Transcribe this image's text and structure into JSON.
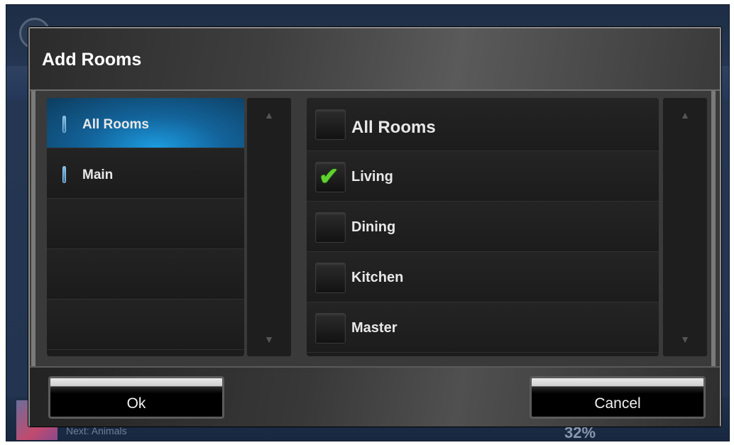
{
  "background": {
    "footer_text": "Next: Animals",
    "percent": "32%"
  },
  "dialog": {
    "title": "Add Rooms",
    "areas": [
      {
        "label": "All Rooms",
        "selected": true
      },
      {
        "label": "Main",
        "selected": false
      }
    ],
    "rooms_header": {
      "label": "All Rooms",
      "checked": false
    },
    "rooms": [
      {
        "label": "Living",
        "checked": true
      },
      {
        "label": "Dining",
        "checked": false
      },
      {
        "label": "Kitchen",
        "checked": false
      },
      {
        "label": "Master",
        "checked": false
      }
    ],
    "buttons": {
      "ok": "Ok",
      "cancel": "Cancel"
    }
  },
  "icons": {
    "check": "check-icon",
    "scroll_up": "chevron-up-icon",
    "scroll_down": "chevron-down-icon"
  },
  "colors": {
    "selection": "#1c9ce0",
    "check": "#5fd12e"
  }
}
